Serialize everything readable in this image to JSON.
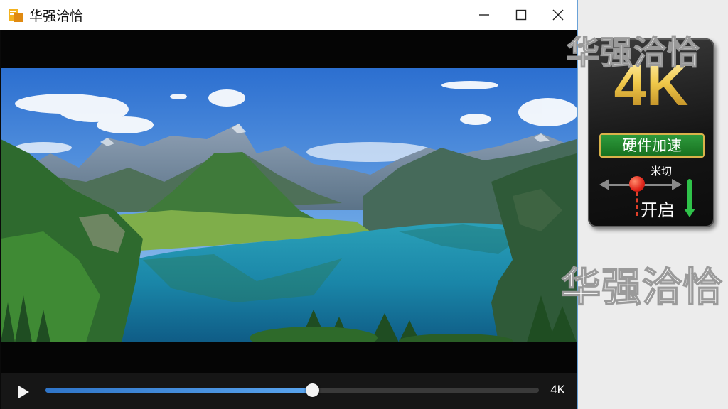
{
  "window": {
    "title": "华强洽恰",
    "controls": [
      "minimize",
      "maximize",
      "close"
    ]
  },
  "player": {
    "play_icon": "play-icon",
    "progress": 0.54,
    "quality": "4K",
    "accent": "#4a95e4"
  },
  "promo": {
    "watermark_top": "华强洽恰",
    "watermark_bottom": "华强洽恰",
    "badge_title": "4K",
    "badge_subtitle": "硬件加速",
    "toggle_hint": "米切",
    "toggle_state": "开启",
    "gold": "#e9c24f",
    "green": "#2e9a3c"
  }
}
